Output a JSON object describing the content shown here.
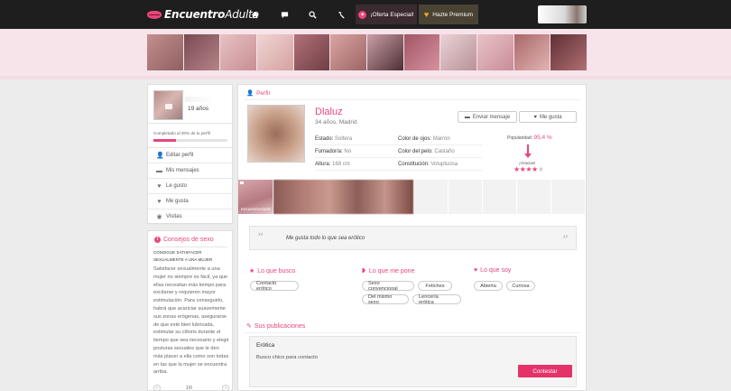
{
  "header": {
    "brand_bold": "Encuentro",
    "brand_light": "Adulto",
    "icons": [
      "home-icon",
      "chat-icon",
      "search-icon",
      "tools-icon"
    ],
    "offer_label": "¡Oferta Especial!",
    "premium_label": "Hazte Premium"
  },
  "sidebar": {
    "age": "19 años",
    "completed_text": "Completado al 30% de tu perfil",
    "completed_pct": 30,
    "menu": [
      {
        "label": "Editar perfil",
        "icon": "user-icon"
      },
      {
        "label": "Mis mensajes",
        "icon": "chat-icon"
      },
      {
        "label": "Le gusto",
        "icon": "hearts-icon"
      },
      {
        "label": "Me gusta",
        "icon": "heart-icon"
      },
      {
        "label": "Visitas",
        "icon": "eye-icon"
      }
    ]
  },
  "tips": {
    "title": "Consejos de sexo",
    "headline": "CONSIGUE SATISFACER SEXUALMENTE A UNA MUJER",
    "body": "Satisfacer sexualmente a una mujer no siempre es fácil, ya que ellas necesitan más tiempo para excitarse y requieren mayor estimulación. Para conseguirlo, habrá que acariciar suavemente sus zonas erógenas, asegurarse de que esté bien lubricada, estimular su clítoris durante el tiempo que sea necesario y elegir posturas sexuales que le den más placer a ella como son todas en las que la mujer se encuentra arriba.",
    "pager": "1/0"
  },
  "profile": {
    "section_title": "Perfil",
    "name": "Dlaluz",
    "meta": "34 años, Madrid",
    "send_message": "Enviar mensaje",
    "like": "Me gusta",
    "attributes": [
      {
        "label": "Estado:",
        "value": "Soltera"
      },
      {
        "label": "Color de ojos:",
        "value": "Marrón"
      },
      {
        "label": "Fumador/a:",
        "value": "No"
      },
      {
        "label": "Color del pelo:",
        "value": "Castaño"
      },
      {
        "label": "Altura:",
        "value": "168 cm"
      },
      {
        "label": "Constitución:",
        "value": "Voluptuosa"
      }
    ],
    "popularity_label": "Popularidad:",
    "popularity_value": "95,4 %",
    "gracias": "¡Gracias!",
    "rating": 4,
    "rating_max": 5,
    "watermark": "EncuentroAdulto",
    "quote": "Me gusta todo lo que sea erótico"
  },
  "preferences": {
    "busco_title": "Lo que busco",
    "busco_tags": [
      "Contacto erótico"
    ],
    "pone_title": "Lo que me pone",
    "pone_tags": [
      "Sexo convencional",
      "Fetiches",
      "Del mismo sexo",
      "Lencería erótica"
    ],
    "soy_title": "Lo que soy",
    "soy_tags": [
      "Abierta",
      "Curiosa"
    ]
  },
  "publications": {
    "title": "Sus publicaciones",
    "post_title": "Erótica",
    "post_text": "Busco chico para contacto",
    "reply_button": "Contestar"
  },
  "colors": {
    "accent": "#e8477a",
    "button": "#e5336a",
    "topbar": "#1e1e1e",
    "band": "#f7e4ea"
  }
}
